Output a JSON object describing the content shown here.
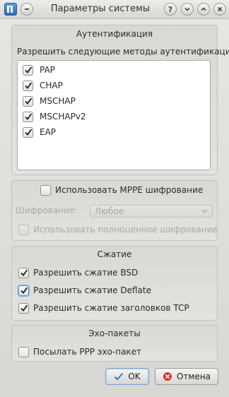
{
  "window": {
    "title": "Параметры системы"
  },
  "auth": {
    "group_title": "Аутентификация",
    "prompt": "Разрешить следующие методы аутентификации:",
    "methods": [
      {
        "label": "PAP",
        "checked": true
      },
      {
        "label": "CHAP",
        "checked": true
      },
      {
        "label": "MSCHAP",
        "checked": true
      },
      {
        "label": "MSCHAPv2",
        "checked": true
      },
      {
        "label": "EAP",
        "checked": true
      }
    ]
  },
  "mppe": {
    "use_label": "Использовать MPPE шифрование",
    "use_checked": false,
    "encryption_label": "Шифрование:",
    "encryption_value": "Любое",
    "full_label": "Использовать полноценное шифрование",
    "full_checked": false
  },
  "compression": {
    "group_title": "Сжатие",
    "bsd_label": "Разрешить сжатие BSD",
    "bsd_checked": true,
    "deflate_label": "Разрешить сжатие Deflate",
    "deflate_checked": true,
    "tcp_label": "Разрешить сжатие заголовков TCP",
    "tcp_checked": true
  },
  "echo": {
    "group_title": "Эхо-пакеты",
    "send_label": "Посылать PPP эхо-пакет",
    "send_checked": false
  },
  "buttons": {
    "ok_label": "OK",
    "cancel_label": "Отмена"
  }
}
